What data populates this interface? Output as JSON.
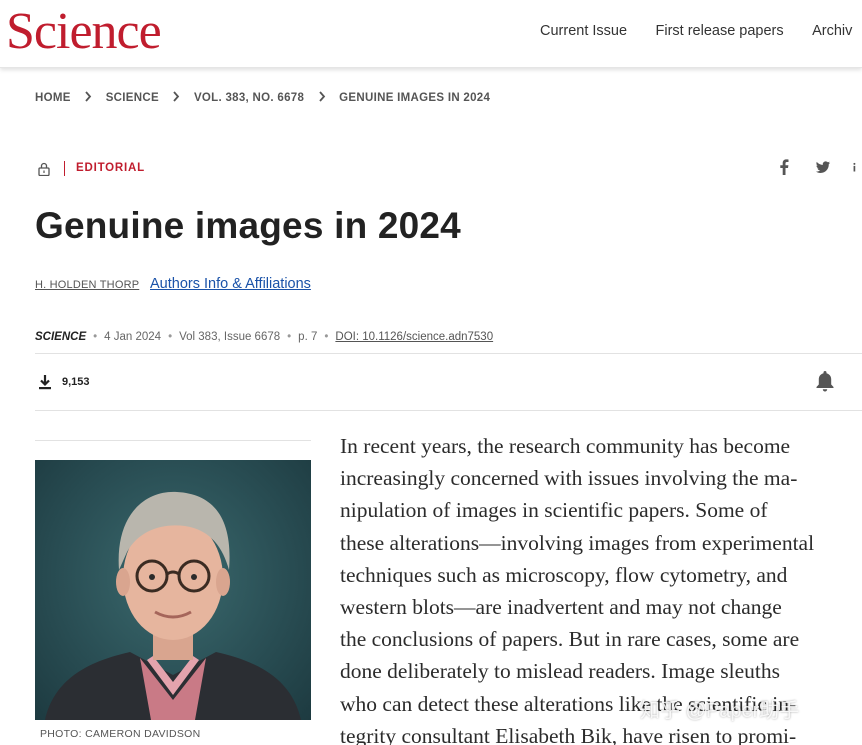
{
  "header": {
    "logo": "Science",
    "nav": [
      "Current Issue",
      "First release papers",
      "Archiv"
    ]
  },
  "breadcrumb": [
    "HOME",
    "SCIENCE",
    "VOL. 383, NO. 6678",
    "GENUINE IMAGES IN 2024"
  ],
  "article": {
    "section": "EDITORIAL",
    "title": "Genuine images in 2024",
    "author": "H. HOLDEN THORP",
    "authors_link": "Authors Info & Affiliations",
    "journal": "SCIENCE",
    "date": "4 Jan 2024",
    "volume": "Vol 383, Issue 6678",
    "page": "p. 7",
    "doi": "DOI: 10.1126/science.adn7530",
    "downloads": "9,153",
    "photo_caption": "PHOTO: CAMERON DAVIDSON",
    "body_lines": [
      "In recent years, the research community has become",
      "increasingly concerned with issues involving the ma-",
      "nipulation of images in scientific papers. Some of",
      "these alterations—involving images from experimental",
      "techniques such as microscopy, flow cytometry, and",
      "western blots—are inadvertent and may not change",
      "the conclusions of papers. But in rare cases, some are",
      "done deliberately to mislead readers. Image sleuths",
      "who can detect these alterations like the scientific in-",
      "tegrity consultant Elisabeth Bik, have risen to promi-"
    ]
  },
  "watermark": "知乎 @Paper助手",
  "colors": {
    "brand_red": "#c01d2e",
    "link_blue": "#1a52a8"
  },
  "icons": [
    "lock-icon",
    "facebook-icon",
    "twitter-icon",
    "linkedin-icon",
    "download-icon",
    "bell-icon",
    "chevron-right-icon"
  ]
}
